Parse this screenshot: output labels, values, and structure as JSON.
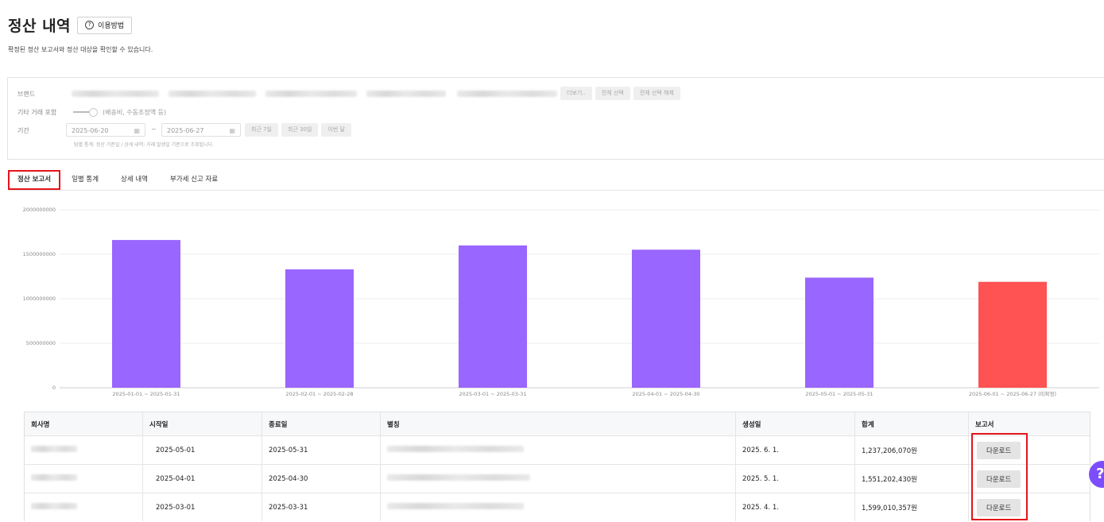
{
  "page": {
    "title": "정산 내역",
    "help_label": "이용방법",
    "subtitle": "확정된 정산 보고서와 정산 대상을 확인할 수 있습니다."
  },
  "filters": {
    "brand_label": "브랜드",
    "more_label": "더보기..",
    "select_all_label": "전체 선택",
    "deselect_all_label": "전체 선택 해제",
    "etc_label": "기타 거래 포함",
    "etc_hint": "(배송비, 수동조정액 등)",
    "period_label": "기간",
    "date_from": "2025-06-20",
    "date_to": "2025-06-27",
    "range_sep": "~",
    "quick_7": "최근 7일",
    "quick_30": "최근 30일",
    "quick_month": "이번 달",
    "period_hint": "탐별 통계: 정산 기준일 / 상세 내역: 거래 발생일 기준으로 조회됩니다."
  },
  "tabs": [
    {
      "label": "정산 보고서",
      "active": true
    },
    {
      "label": "일별 통계",
      "active": false
    },
    {
      "label": "상세 내역",
      "active": false
    },
    {
      "label": "부가세 신고 자료",
      "active": false
    }
  ],
  "chart_data": {
    "type": "bar",
    "categories": [
      "2025-01-01 ~ 2025-01-31",
      "2025-02-01 ~ 2025-02-28",
      "2025-03-01 ~ 2025-03-31",
      "2025-04-01 ~ 2025-04-30",
      "2025-05-01 ~ 2025-05-31",
      "2025-06-01 ~ 2025-06-27 (미확정)"
    ],
    "values": [
      1660000000,
      1330000000,
      1599010357,
      1551202430,
      1237206070,
      1190000000
    ],
    "colors": [
      "#9966ff",
      "#9966ff",
      "#9966ff",
      "#9966ff",
      "#9966ff",
      "#ff5252"
    ],
    "yticks": [
      "0",
      "500000000",
      "1000000000",
      "1500000000",
      "2000000000"
    ],
    "ylim": [
      0,
      2000000000
    ],
    "grid": true
  },
  "table": {
    "headers": [
      "회사명",
      "시작일",
      "종료일",
      "별칭",
      "생성일",
      "합계",
      "보고서"
    ],
    "rows": [
      {
        "start": "2025-05-01",
        "end": "2025-05-31",
        "created": "2025. 6. 1.",
        "total": "1,237,206,070원",
        "action": "다운로드"
      },
      {
        "start": "2025-04-01",
        "end": "2025-04-30",
        "created": "2025. 5. 1.",
        "total": "1,551,202,430원",
        "action": "다운로드"
      },
      {
        "start": "2025-03-01",
        "end": "2025-03-31",
        "created": "2025. 4. 1.",
        "total": "1,599,010,357원",
        "action": "다운로드"
      }
    ]
  },
  "float_help_label": "?"
}
